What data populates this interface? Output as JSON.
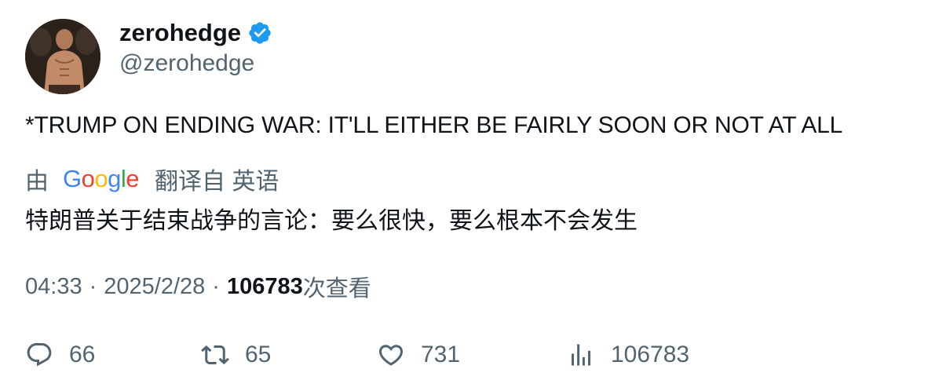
{
  "author": {
    "display_name": "zerohedge",
    "handle": "@zerohedge",
    "verified_icon": "verified-badge-icon",
    "verified_color": "#1d9bf0"
  },
  "tweet": {
    "text": "*TRUMP ON ENDING WAR: IT'LL EITHER BE FAIRLY SOON OR NOT AT ALL"
  },
  "translation": {
    "prefix": "由",
    "provider": "Google",
    "suffix": "翻译自 英语",
    "text": "特朗普关于结束战争的言论：要么很快，要么根本不会发生"
  },
  "meta": {
    "time": "04:33",
    "separator": "·",
    "date": "2025/2/28",
    "views_count": "106783",
    "views_label": "次查看"
  },
  "actions": {
    "replies": {
      "icon": "reply-icon",
      "count": "66"
    },
    "retweets": {
      "icon": "retweet-icon",
      "count": "65"
    },
    "likes": {
      "icon": "heart-icon",
      "count": "731"
    },
    "views": {
      "icon": "analytics-icon",
      "count": "106783"
    }
  },
  "colors": {
    "text_primary": "#0f1419",
    "text_secondary": "#536471",
    "google_blue": "#4285f4",
    "google_red": "#ea4335",
    "google_yellow": "#fbbc05",
    "google_green": "#34a853"
  }
}
